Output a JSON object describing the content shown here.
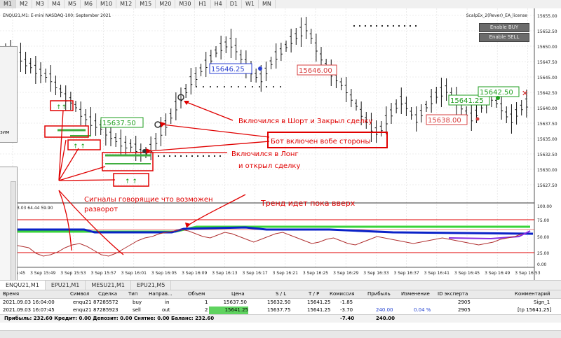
{
  "timeframes": [
    "M1",
    "M2",
    "M3",
    "M4",
    "M5",
    "M6",
    "M10",
    "M12",
    "M15",
    "M20",
    "M30",
    "H1",
    "H4",
    "D1",
    "W1",
    "MN"
  ],
  "active_timeframe": "M1",
  "chart_header": "ENQU21,M1:  E-mini NASDAQ-100: September 2021",
  "expert_name": "ScalpEx_2(Rever)_EA_license",
  "enable_buy_label": "Enable BUY",
  "enable_sell_label": "Enable SELL",
  "price_axis": [
    "15655.00",
    "15652.50",
    "15650.00",
    "15647.50",
    "15645.00",
    "15642.50",
    "15640.00",
    "15637.50",
    "15635.00",
    "15632.50",
    "15630.00",
    "15627.50"
  ],
  "indicator_axis": [
    "100.00",
    "75.00",
    "50.00",
    "25.00",
    "0.00"
  ],
  "indicator_label": "3.03 64.44 59.90",
  "time_axis": [
    "3 Sep 15:45",
    "3 Sep 15:49",
    "3 Sep 15:53",
    "3 Sep 15:57",
    "3 Sep 16:01",
    "3 Sep 16:05",
    "3 Sep 16:09",
    "3 Sep 16:13",
    "3 Sep 16:17",
    "3 Sep 16:21",
    "3 Sep 16:25",
    "3 Sep 16:29",
    "3 Sep 16:33",
    "3 Sep 16:37",
    "3 Sep 16:41",
    "3 Sep 16:45",
    "3 Sep 16:49",
    "3 Sep 16:53"
  ],
  "price_labels": [
    "15637.50",
    "15646.25",
    "15646.00",
    "15638.00",
    "15641.25",
    "15642.50"
  ],
  "annotations": {
    "short": "Включился в Шорт и Закрыл сделку",
    "both": "Бот включен вобе стороны",
    "long1": "Включился в Лонг",
    "long2": "и открыл сделку",
    "signals1": "Сигналы говорящие что возможен",
    "signals2": "разворот",
    "trend": "Тренд  идет пока вверх"
  },
  "left_panel_top_label": "зим",
  "left_panel_bot_label": "Oт",
  "chart_tabs": [
    "ENQU21,M1",
    "EPU21,M1",
    "MESU21,M1",
    "EPU21,M5"
  ],
  "table": {
    "headers": [
      "Время",
      "Символ",
      "Сделка",
      "Тип",
      "Направ...",
      "Объем",
      "Цена",
      "S / L",
      "T / P",
      "Комиссия",
      "Прибыль",
      "Изменение",
      "ID эксперта",
      "Комментарий"
    ],
    "rows": [
      [
        "2021.09.03 16:04:00",
        "enqu21",
        "87285572",
        "buy",
        "in",
        "1",
        "15637.50",
        "15632.50",
        "15641.25",
        "-1.85",
        "",
        "",
        "2905",
        "Sign_1"
      ],
      [
        "2021.09.03 16:07:45",
        "enqu21",
        "87285923",
        "sell",
        "out",
        "2",
        "15641.25",
        "15637.75",
        "15641.25",
        "-3.70",
        "240.00",
        "0.04 %",
        "2905",
        "[tp 15641.25]"
      ]
    ],
    "summary": "Прибыль: 232.60  Кредит: 0.00  Депозит: 0.00  Снятие: 0.00  Баланс: 232.60",
    "summary_commission": "-7.40",
    "summary_profit": "240.00"
  },
  "colors": {
    "annotation_red": "#e00000",
    "bull_green": "#1e9e1e",
    "blue_line": "#0a22c8",
    "green_line": "#3ad43a",
    "price_red": "#d74040"
  }
}
